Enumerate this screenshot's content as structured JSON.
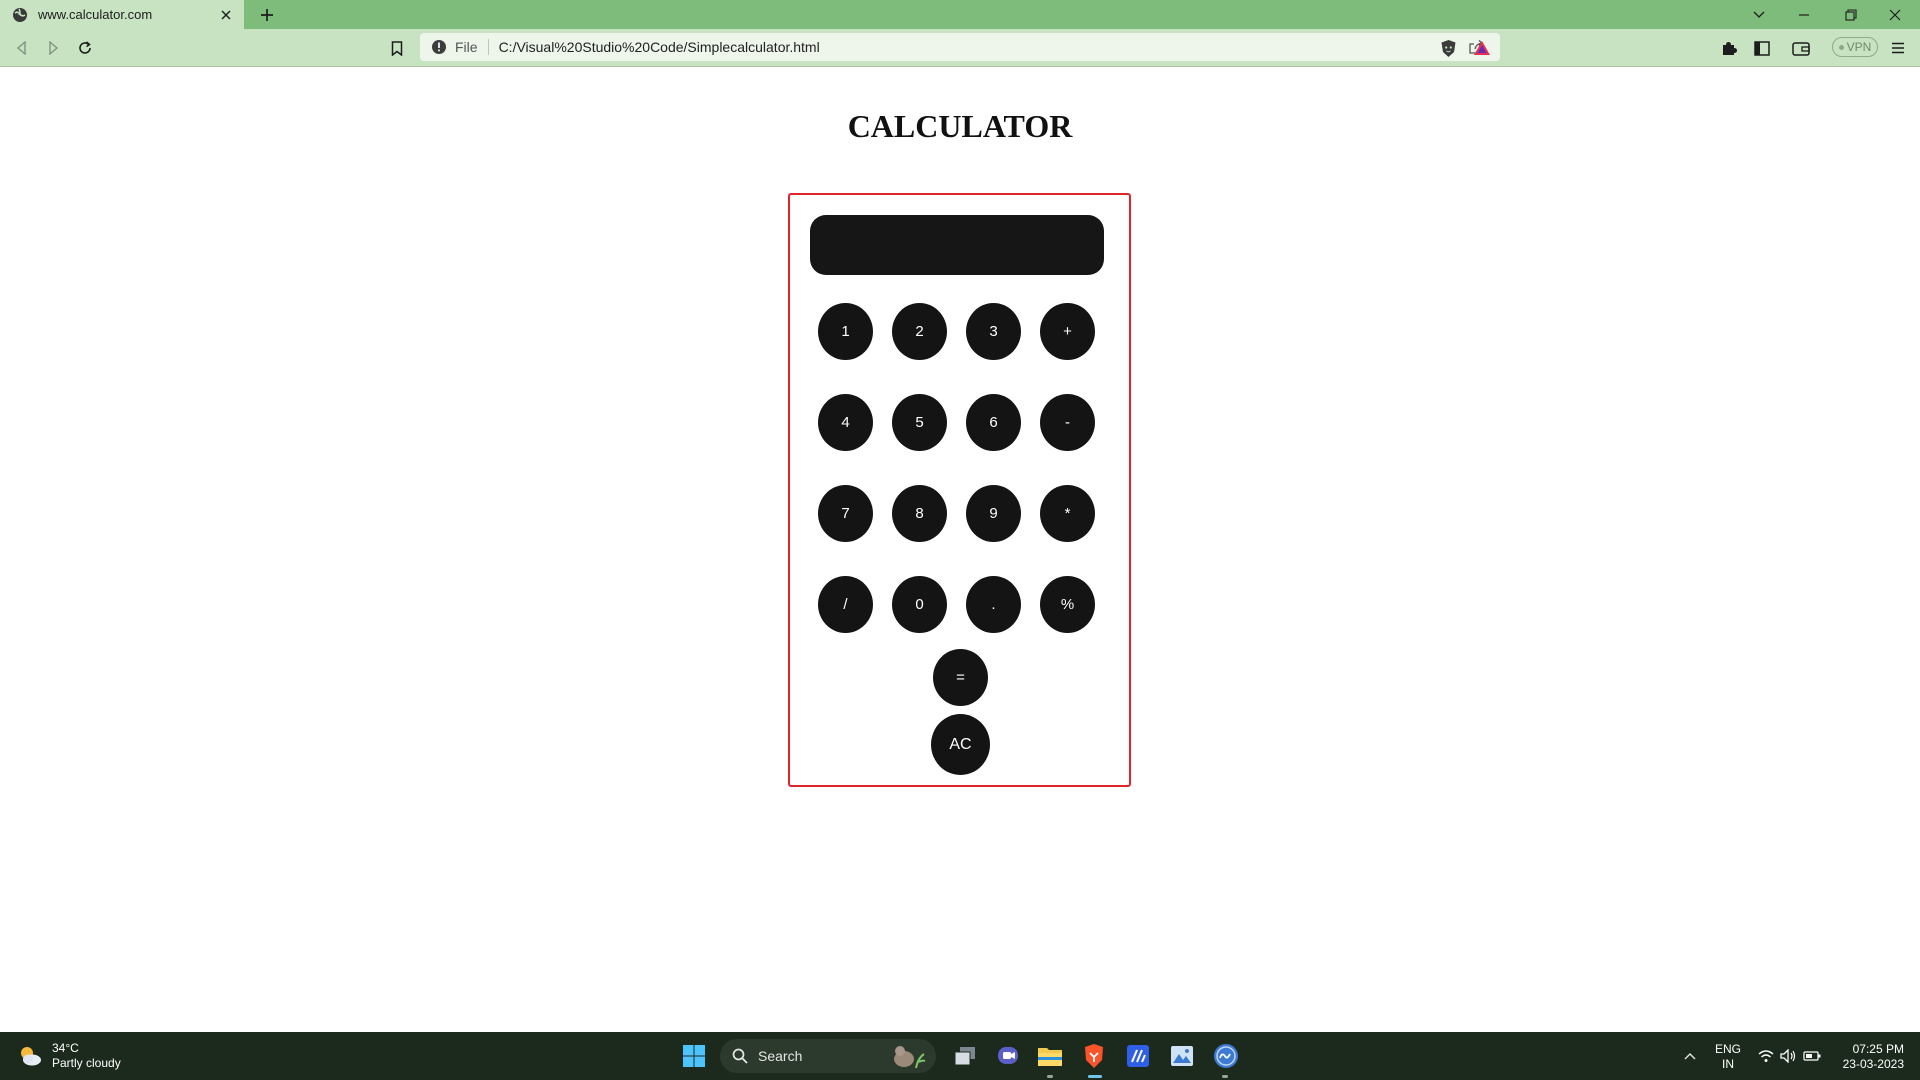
{
  "browser": {
    "tab_title": "www.calculator.com",
    "address_scheme": "File",
    "address_url": "C:/Visual%20Studio%20Code/Simplecalculator.html",
    "vpn_label": "VPN",
    "colors": {
      "tabstrip": "#7ebc7c",
      "toolbar": "#c7e3c2"
    }
  },
  "page": {
    "title": "CALCULATOR",
    "display_value": "",
    "keys": {
      "k1": "1",
      "k2": "2",
      "k3": "3",
      "kplus": "+",
      "k4": "4",
      "k5": "5",
      "k6": "6",
      "kminus": "-",
      "k7": "7",
      "k8": "8",
      "k9": "9",
      "kmul": "*",
      "kdiv": "/",
      "k0": "0",
      "kdot": ".",
      "kpct": "%",
      "keq": "=",
      "kac": "AC"
    },
    "colors": {
      "key_bg": "#141414",
      "border": "#e0242c"
    }
  },
  "taskbar": {
    "weather_temp": "34°C",
    "weather_desc": "Partly cloudy",
    "search_label": "Search",
    "lang_top": "ENG",
    "lang_bottom": "IN",
    "time": "07:25 PM",
    "date": "23-03-2023"
  }
}
